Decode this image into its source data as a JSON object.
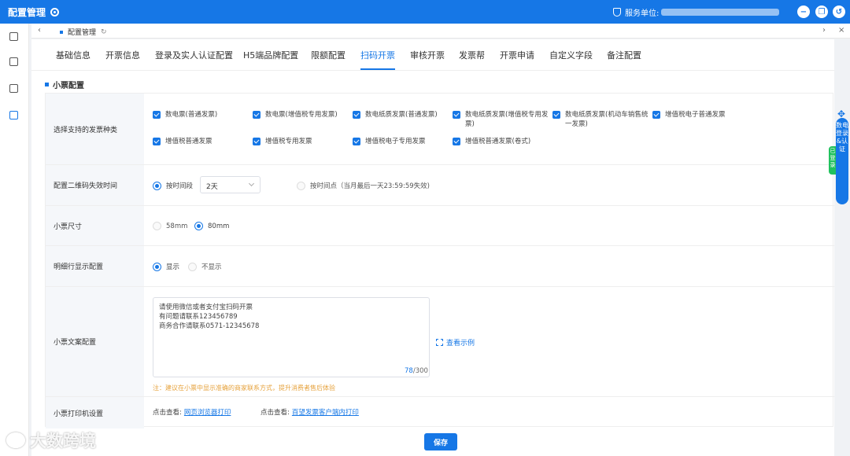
{
  "app": {
    "title": "配置管理"
  },
  "topbar": {
    "unit_label": "服务单位:"
  },
  "tabbar": {
    "current_tab": "配置管理"
  },
  "nav": {
    "tabs": [
      "基础信息",
      "开票信息",
      "登录及实人认证配置",
      "H5端品牌配置",
      "限额配置",
      "扫码开票",
      "审核开票",
      "发票帮",
      "开票申请",
      "自定义字段",
      "备注配置"
    ],
    "active": "扫码开票"
  },
  "section": {
    "title": "小票配置"
  },
  "invoice_types": {
    "label": "选择支持的发票种类",
    "items": [
      "数电票(普通发票)",
      "数电票(增值税专用发票)",
      "数电纸质发票(普通发票)",
      "数电纸质发票(增值税专用发票)",
      "数电纸质发票(机动车销售统一发票)",
      "增值税电子普通发票",
      "增值税普通发票",
      "增值税专用发票",
      "增值税电子专用发票",
      "增值税普通发票(卷式)"
    ]
  },
  "qr_expiry": {
    "label": "配置二维码失效时间",
    "option_period": "按时间段",
    "period_value": "2天",
    "option_point": "按时间点（当月最后一天23:59:59失效)"
  },
  "ticket_size": {
    "label": "小票尺寸",
    "options": [
      "58mm",
      "80mm"
    ],
    "selected": "80mm"
  },
  "detail_display": {
    "label": "明细行显示配置",
    "options": [
      "显示",
      "不显示"
    ],
    "selected": "显示"
  },
  "ticket_text": {
    "label": "小票文案配置",
    "value": "请使用微信或者支付宝扫码开票\n有问题请联系123456789\n商务合作请联系0571-12345678",
    "count_current": "78",
    "count_max": "/300",
    "example": "查看示例",
    "hint": "注：建议在小票中显示准确的商家联系方式，提升消费者售后体验"
  },
  "printer": {
    "label": "小票打印机设置",
    "click_view": "点击查看:",
    "link1": "网页浏览器打印",
    "link2": "百望发票客户端内打印"
  },
  "save_label": "保存",
  "watermark": "大数跨境",
  "side_panel": {
    "text": "数电登录&认证",
    "green": "已登录"
  }
}
